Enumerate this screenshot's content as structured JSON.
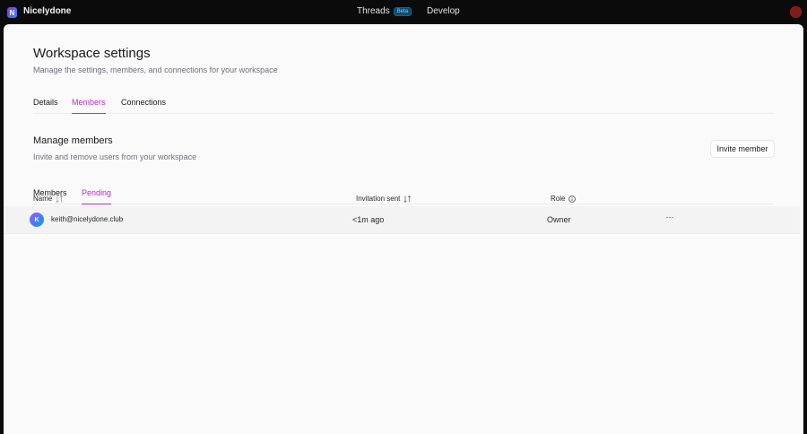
{
  "app": {
    "logo_letter": "N",
    "brand": "Nicelydone",
    "nav": {
      "threads": "Threads",
      "beta_badge": "Beta",
      "develop": "Develop"
    }
  },
  "page": {
    "title": "Workspace settings",
    "subtitle": "Manage the settings, members, and connections for your workspace",
    "tabs": [
      {
        "label": "Details",
        "active": false
      },
      {
        "label": "Members",
        "active": true
      },
      {
        "label": "Connections",
        "active": false
      }
    ]
  },
  "members_section": {
    "title": "Manage members",
    "subtitle": "Invite and remove users from your workspace",
    "invite_button": "Invite member",
    "subtabs": [
      {
        "label": "Members",
        "active": false
      },
      {
        "label": "Pending",
        "active": true
      }
    ],
    "columns": {
      "name": "Name",
      "invitation_sent": "Invitation sent",
      "role": "Role"
    },
    "rows": [
      {
        "initial": "K",
        "email": "keith@nicelydone.club",
        "sent": "<1m ago",
        "role": "Owner",
        "menu": "···"
      }
    ]
  },
  "colors": {
    "accent": "#c026d3",
    "background": "#0b0b0c",
    "panel": "#fafafa"
  }
}
